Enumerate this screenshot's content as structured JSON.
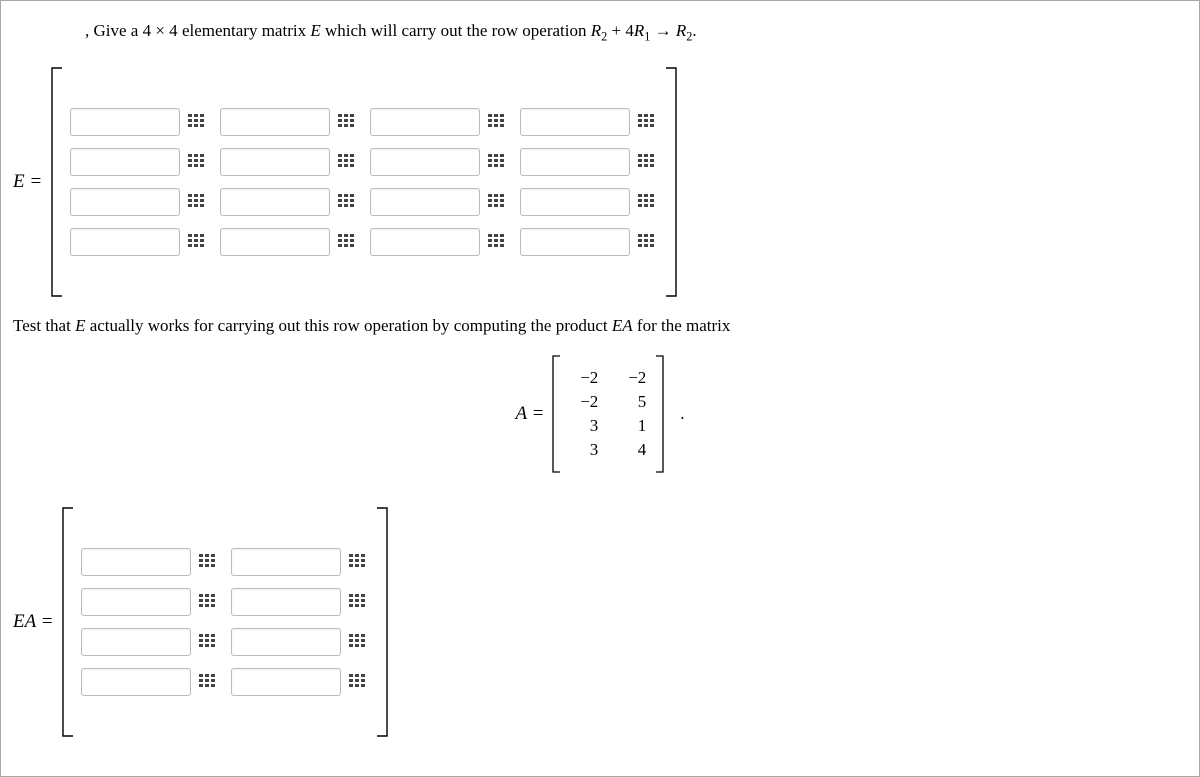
{
  "prompt": {
    "prefix": ", Give a ",
    "size": "4 × 4",
    "mid1": " elementary matrix ",
    "E": "E",
    "mid2": " which will carry out the row operation ",
    "rowop_lhs_a": "R",
    "rowop_lhs_a_sub": "2",
    "rowop_plus": " + 4",
    "rowop_lhs_b": "R",
    "rowop_lhs_b_sub": "1",
    "rowop_arrow": " → ",
    "rowop_rhs": "R",
    "rowop_rhs_sub": "2",
    "rowop_end": "."
  },
  "labels": {
    "E_eq": "E =",
    "EA_eq": "EA =",
    "A_eq": "A ="
  },
  "test_text": {
    "prefix": "Test that ",
    "E": "E",
    "mid": " actually works for carrying out this row operation by computing the product ",
    "EA": "EA",
    "suffix": " for the matrix"
  },
  "A_matrix": {
    "rows": [
      [
        "−2",
        "−2"
      ],
      [
        "−2",
        "5"
      ],
      [
        "3",
        "1"
      ],
      [
        "3",
        "4"
      ]
    ]
  },
  "period": ".",
  "E_inputs": {
    "rows": 4,
    "cols": 4
  },
  "EA_inputs": {
    "rows": 4,
    "cols": 2
  }
}
